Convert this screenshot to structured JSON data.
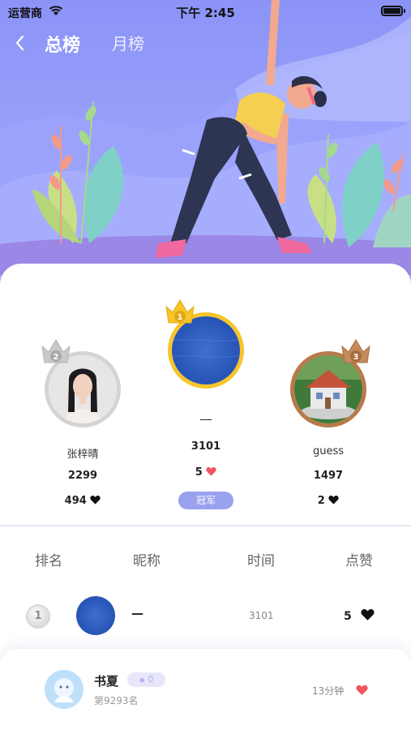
{
  "status_bar": {
    "carrier": "运营商",
    "time": "下午 2:45"
  },
  "nav": {
    "tabs": [
      "总榜",
      "月榜"
    ]
  },
  "podium": {
    "second": {
      "rank": "2",
      "name": "张梓晴",
      "score": "2299",
      "likes": "494"
    },
    "first": {
      "rank": "1",
      "name": "—",
      "score": "3101",
      "likes": "5",
      "tag": "冠军"
    },
    "third": {
      "rank": "3",
      "name": "guess",
      "score": "1497",
      "likes": "2"
    }
  },
  "table": {
    "headers": [
      "排名",
      "昵称",
      "时间",
      "点赞"
    ],
    "rows": [
      {
        "rank": "1",
        "nickname": "—",
        "time": "3101",
        "likes": "5"
      }
    ]
  },
  "me": {
    "name": "书夏",
    "badge": "0",
    "rank_text": "第9293名",
    "time": "13分钟"
  },
  "colors": {
    "accent": "#7d86f0",
    "heart_red": "#f2555f",
    "gold": "#f7c52a",
    "silver": "#c9c9c9",
    "bronze": "#b97a4a"
  }
}
